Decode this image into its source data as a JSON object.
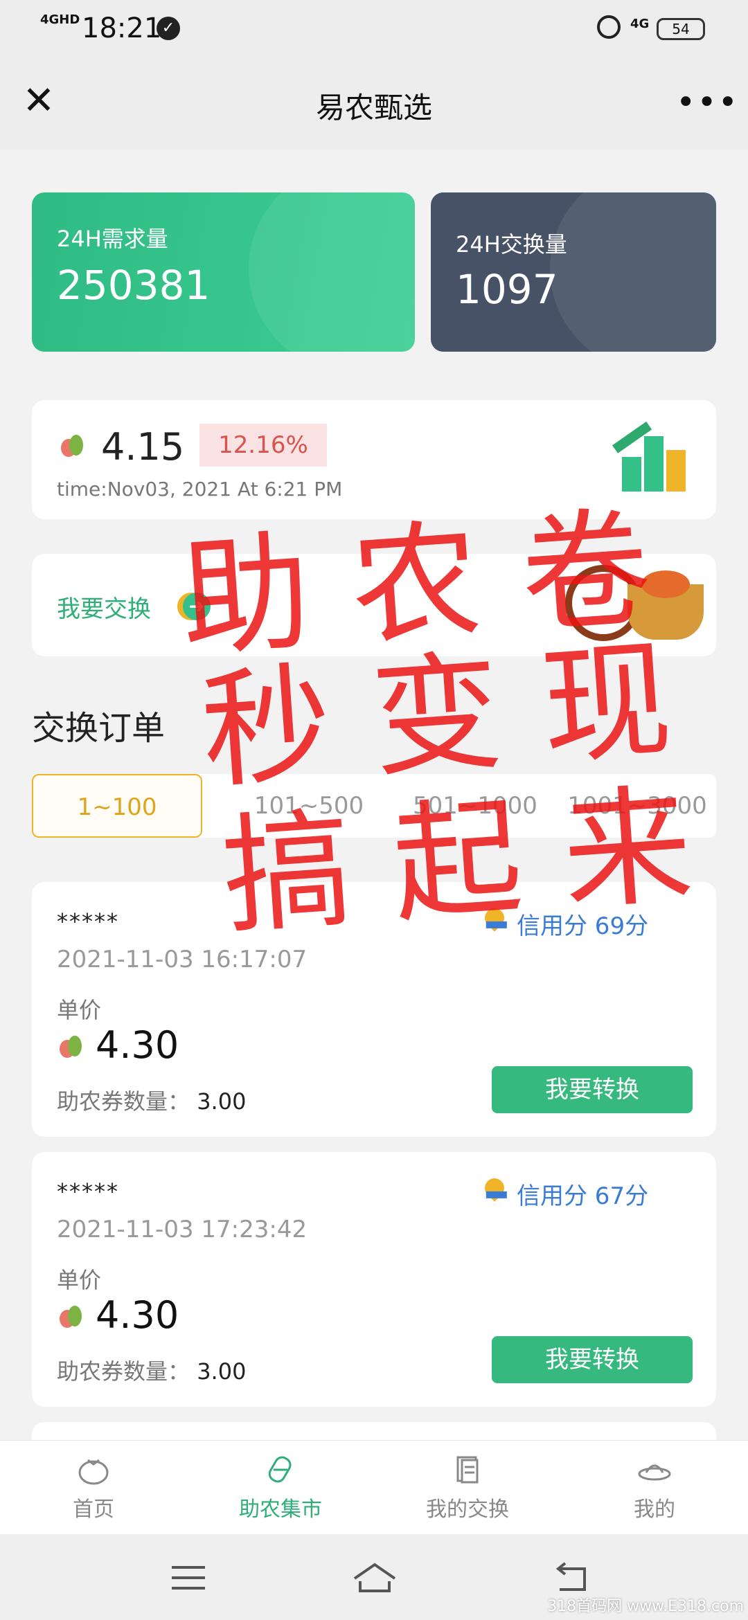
{
  "status_bar": {
    "time": "18:21",
    "signal": "4GHD",
    "network": "4G",
    "battery": "54"
  },
  "nav": {
    "title": "易农甄选"
  },
  "stats": {
    "demand_label": "24H需求量",
    "demand_value": "250381",
    "exchange_label": "24H交换量",
    "exchange_value": "1097"
  },
  "price_card": {
    "price": "4.15",
    "change": "12.16%",
    "time": "time:Nov03, 2021 At 6:21 PM"
  },
  "exchange_card": {
    "label": "我要交换"
  },
  "orders_section": {
    "title": "交换订单"
  },
  "tabs": [
    "1~100",
    "101~500",
    "501~1000",
    "1001~3000"
  ],
  "orders": [
    {
      "name": "*****",
      "date": "2021-11-03 16:17:07",
      "credit": "信用分 69分",
      "unit_label": "单价",
      "price": "4.30",
      "qty_label": "助农券数量：",
      "qty": "3.00",
      "button": "我要转换"
    },
    {
      "name": "*****",
      "date": "2021-11-03 17:23:42",
      "credit": "信用分 67分",
      "unit_label": "单价",
      "price": "4.30",
      "qty_label": "助农券数量：",
      "qty": "3.00",
      "button": "我要转换"
    }
  ],
  "tabbar": [
    {
      "label": "首页",
      "icon": "tomato-icon"
    },
    {
      "label": "助农集市",
      "icon": "market-icon",
      "active": true
    },
    {
      "label": "我的交换",
      "icon": "document-icon"
    },
    {
      "label": "我的",
      "icon": "hat-icon"
    }
  ],
  "watermark": {
    "line1": "助农卷",
    "line2": "秒变现",
    "line3": "搞起来",
    "corner": "318首码网 www.E318.com"
  },
  "colors": {
    "green": "#35b97e",
    "slate": "#475266",
    "red": "#d9534f",
    "gold": "#f0b429",
    "blue": "#3a7bd5"
  }
}
